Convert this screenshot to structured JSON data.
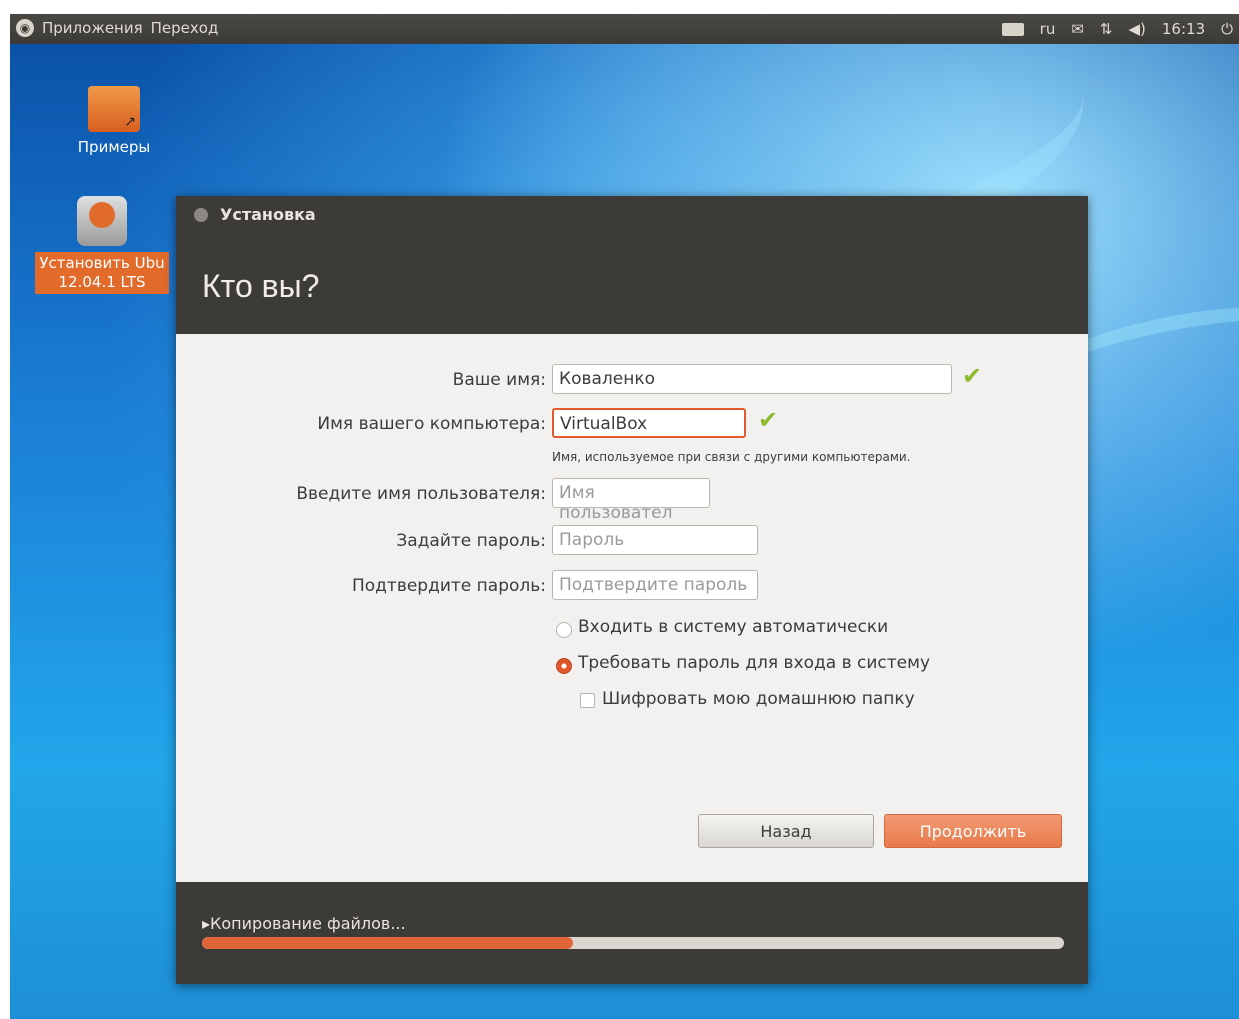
{
  "top_panel": {
    "apps_menu": "Приложения",
    "places_menu": "Переход",
    "keyboard_layout": "ru",
    "clock": "16:13"
  },
  "desktop": {
    "icons": [
      {
        "label": "Примеры"
      },
      {
        "label_line1": "Установить Ubu",
        "label_line2": "12.04.1 LTS"
      }
    ]
  },
  "installer": {
    "window_title": "Установка",
    "page_heading": "Кто вы?",
    "form": {
      "name_label": "Ваше имя:",
      "name_value": "Коваленко",
      "computer_label": "Имя вашего компьютера:",
      "computer_value": "VirtualBox",
      "computer_hint": "Имя, используемое при связи с другими компьютерами.",
      "username_label": "Введите имя пользователя:",
      "username_placeholder": "Имя пользовател",
      "password_label": "Задайте пароль:",
      "password_placeholder": "Пароль",
      "confirm_label": "Подтвердите пароль:",
      "confirm_placeholder": "Подтвердите пароль",
      "option_autologin": "Входить в систему автоматически",
      "option_require_password": "Требовать пароль для входа в систему",
      "option_encrypt_home": "Шифровать мою домашнюю папку",
      "selected_option": "option_require_password",
      "encrypt_checked": false
    },
    "buttons": {
      "back": "Назад",
      "continue": "Продолжить"
    },
    "progress": {
      "label": "Копирование файлов...",
      "fraction": 0.43
    }
  },
  "colors": {
    "accent": "#e0663a",
    "window_dark": "#3c3b37",
    "checkmark": "#8cbb2c"
  }
}
